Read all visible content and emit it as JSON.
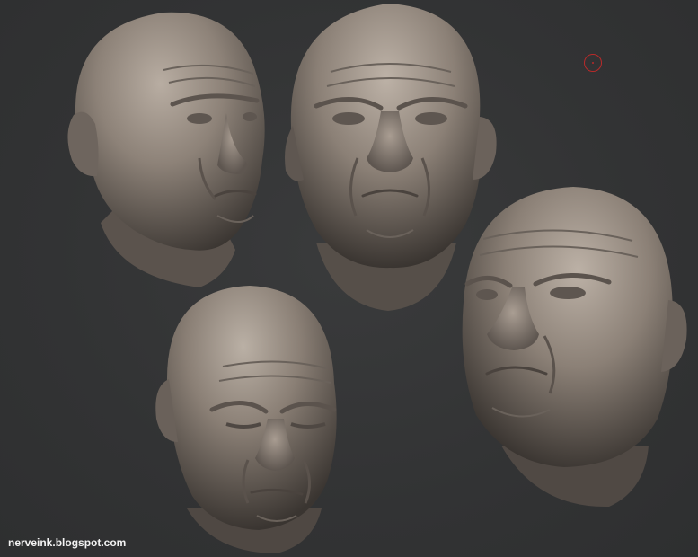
{
  "canvas": {
    "background_color": "#333435",
    "material_color": "#8c8178",
    "heads": [
      {
        "view": "three-quarter-right"
      },
      {
        "view": "front-tilted-up"
      },
      {
        "view": "front-down"
      },
      {
        "view": "three-quarter-left-tilted-up"
      }
    ],
    "cursor": {
      "icon": "brush-circle-icon",
      "color": "#b82a2a"
    }
  },
  "watermark": {
    "text": "nerveink.blogspot.com"
  }
}
